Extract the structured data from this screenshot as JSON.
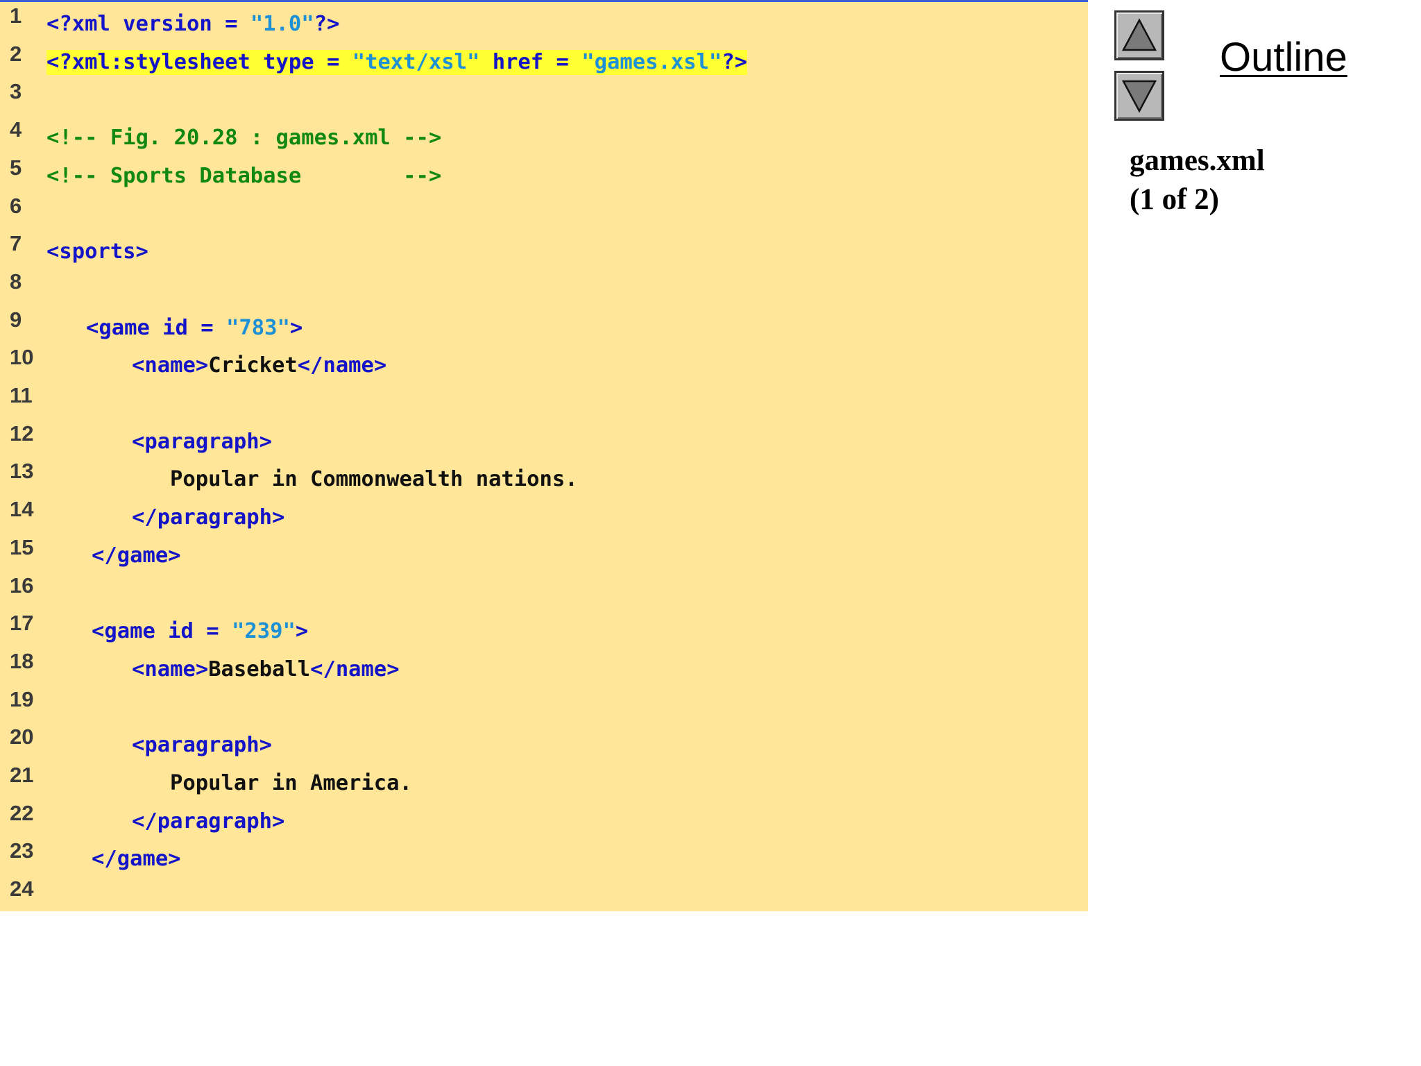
{
  "code_lines": [
    {
      "num": "1",
      "tokens": [
        [
          "tag",
          "<?xml version = "
        ],
        [
          "str",
          "\"1.0\""
        ],
        [
          "tag",
          "?>"
        ]
      ]
    },
    {
      "num": "2",
      "highlight": true,
      "tokens": [
        [
          "tag",
          "<?xml:stylesheet type = "
        ],
        [
          "str",
          "\"text/xsl\""
        ],
        [
          "tag",
          " href = "
        ],
        [
          "str",
          "\"games.xsl\""
        ],
        [
          "tag",
          "?>"
        ]
      ]
    },
    {
      "num": "3",
      "tokens": []
    },
    {
      "num": "4",
      "tokens": [
        [
          "comment",
          "<!-- Fig. 20.28 : games.xml -->"
        ]
      ]
    },
    {
      "num": "5",
      "tokens": [
        [
          "comment",
          "<!-- Sports Database        -->"
        ]
      ]
    },
    {
      "num": "6",
      "tokens": []
    },
    {
      "num": "7",
      "tokens": [
        [
          "tag",
          "<sports>"
        ]
      ]
    },
    {
      "num": "8",
      "tokens": []
    },
    {
      "num": "9",
      "tokens": [
        [
          "tag",
          "<game id = "
        ],
        [
          "str",
          "\"783\""
        ],
        [
          "tag",
          ">"
        ]
      ]
    },
    {
      "num": "10",
      "tokens": [
        [
          "tag",
          "<name>"
        ],
        [
          "text",
          "Cricket"
        ],
        [
          "tag",
          "</name>"
        ]
      ]
    },
    {
      "num": "11",
      "tokens": []
    },
    {
      "num": "12",
      "tokens": [
        [
          "tag",
          "<paragraph>"
        ]
      ]
    },
    {
      "num": "13",
      "tokens": [
        [
          "text",
          "Popular in Commonwealth nations."
        ]
      ]
    },
    {
      "num": "14",
      "tokens": [
        [
          "tag",
          "</paragraph>"
        ]
      ]
    },
    {
      "num": "15",
      "tokens": [
        [
          "tag",
          "</game>"
        ]
      ]
    },
    {
      "num": "16",
      "tokens": []
    },
    {
      "num": "17",
      "tokens": [
        [
          "tag",
          "<game id = "
        ],
        [
          "str",
          "\"239\""
        ],
        [
          "tag",
          ">"
        ]
      ]
    },
    {
      "num": "18",
      "tokens": [
        [
          "tag",
          "<name>"
        ],
        [
          "text",
          "Baseball"
        ],
        [
          "tag",
          "</name>"
        ]
      ]
    },
    {
      "num": "19",
      "tokens": []
    },
    {
      "num": "20",
      "tokens": [
        [
          "tag",
          "<paragraph>"
        ]
      ]
    },
    {
      "num": "21",
      "tokens": [
        [
          "text",
          "Popular in America."
        ]
      ]
    },
    {
      "num": "22",
      "tokens": [
        [
          "tag",
          "</paragraph>"
        ]
      ]
    },
    {
      "num": "23",
      "tokens": [
        [
          "tag",
          "</game>"
        ]
      ]
    },
    {
      "num": "24",
      "tokens": []
    }
  ],
  "sidebar": {
    "outline_label": "Outline",
    "file_name": "games.xml",
    "page_indicator": "(1 of 2)",
    "up_button_icon": "triangle-up-icon",
    "down_button_icon": "triangle-down-icon"
  },
  "colors": {
    "panel_background": "#FFE699",
    "tag": "#1414C8",
    "string": "#1E90D6",
    "comment": "#118811",
    "text": "#111111",
    "highlight": "#FFFF33"
  }
}
